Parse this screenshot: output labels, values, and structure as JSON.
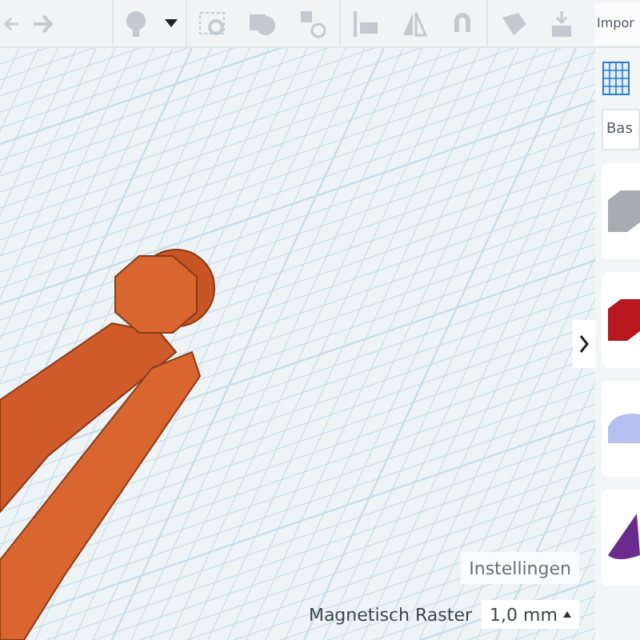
{
  "toolbar": {
    "import_label": "Impor"
  },
  "shapes_panel": {
    "library_field": "Bas"
  },
  "settings_button": "Instellingen",
  "snap_grid": {
    "label": "Magnetisch Raster",
    "value": "1,0 mm"
  }
}
